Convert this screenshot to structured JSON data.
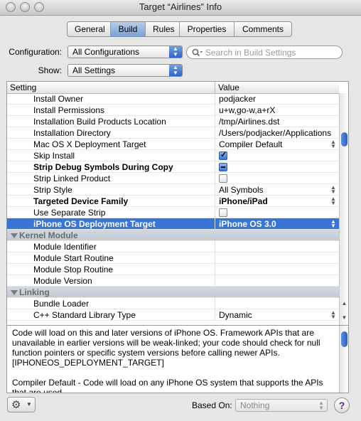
{
  "window": {
    "title": "Target “Airlines” Info"
  },
  "tabs": [
    {
      "label": "General",
      "active": false
    },
    {
      "label": "Build",
      "active": true
    },
    {
      "label": "Rules",
      "active": false
    },
    {
      "label": "Properties",
      "active": false
    },
    {
      "label": "Comments",
      "active": false
    }
  ],
  "configuration": {
    "label": "Configuration:",
    "value": "All Configurations"
  },
  "show": {
    "label": "Show:",
    "value": "All Settings"
  },
  "search": {
    "placeholder": "Search in Build Settings",
    "icon": "search-icon"
  },
  "table": {
    "headers": {
      "setting": "Setting",
      "value": "Value"
    },
    "rows": [
      {
        "name": "Install Owner",
        "value": "podjacker"
      },
      {
        "name": "Install Permissions",
        "value": "u+w,go-w,a+rX"
      },
      {
        "name": "Installation Build Products Location",
        "value": "/tmp/Airlines.dst"
      },
      {
        "name": "Installation Directory",
        "value": "/Users/podjacker/Applications"
      },
      {
        "name": "Mac OS X Deployment Target",
        "value": "Compiler Default",
        "popup": true
      },
      {
        "name": "Skip Install",
        "checkbox": "checked"
      },
      {
        "name": "Strip Debug Symbols During Copy",
        "checkbox": "mixed",
        "bold": true
      },
      {
        "name": "Strip Linked Product",
        "checkbox": "unchecked"
      },
      {
        "name": "Strip Style",
        "value": "All Symbols",
        "popup": true
      },
      {
        "name": "Targeted Device Family",
        "value": "iPhone/iPad",
        "popup": true,
        "bold": true
      },
      {
        "name": "Use Separate Strip",
        "checkbox": "unchecked"
      },
      {
        "name": "iPhone OS Deployment Target",
        "value": "iPhone OS 3.0",
        "popup": true,
        "selected": true
      },
      {
        "name": "Kernel Module",
        "group": true
      },
      {
        "name": "Module Identifier",
        "value": ""
      },
      {
        "name": "Module Start Routine",
        "value": ""
      },
      {
        "name": "Module Stop Routine",
        "value": ""
      },
      {
        "name": "Module Version",
        "value": ""
      },
      {
        "name": "Linking",
        "group": true
      },
      {
        "name": "Bundle Loader",
        "value": ""
      },
      {
        "name": "C++ Standard Library Type",
        "value": "Dynamic",
        "popup": true
      }
    ]
  },
  "description": {
    "para1": "Code will load on this and later versions of iPhone OS.  Framework APIs that are unavailable in earlier versions will be weak-linked; your code should check for null function pointers or specific system versions before calling newer APIs. [IPHONEOS_DEPLOYMENT_TARGET]",
    "para2": "Compiler Default - Code will load on any iPhone OS system that supports the APIs that are used"
  },
  "footer": {
    "based_on_label": "Based On:",
    "based_on_value": "Nothing",
    "help": "?"
  },
  "colors": {
    "selection": "#3875d7",
    "accent": "#2d64c6"
  }
}
